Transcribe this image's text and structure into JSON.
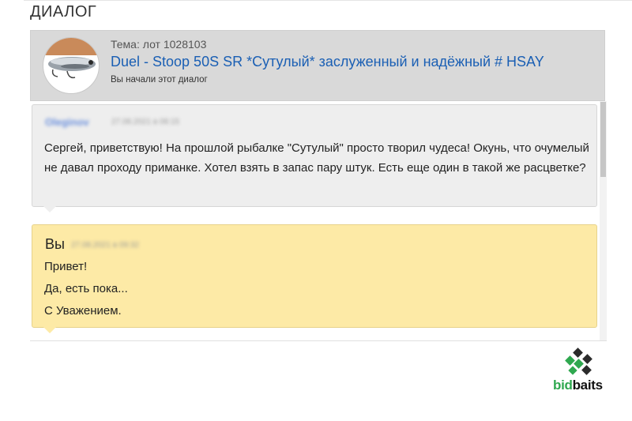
{
  "page": {
    "title": "ДИАЛОГ"
  },
  "topic": {
    "label": "Тема: лот 1028103",
    "link_text": "Duel - Stoop 50S SR *Сутулый* заслуженный и надёжный # HSAY",
    "note": "Вы начали этот диалог"
  },
  "messages": [
    {
      "sender": "Oleginov",
      "timestamp": "27.08.2021 в 08:15",
      "text": "Сергей, приветствую! На прошлой рыбалке \"Сутулый\" просто творил чудеса! Окунь, что очумелый не давал проходу приманке. Хотел взять в запас пару штук. Есть еще один в такой же расцветке?"
    },
    {
      "sender": "Вы",
      "timestamp": "27.08.2021 в 09:32",
      "lines": [
        "Привет!",
        "Да, есть пока...",
        "С Уважением."
      ]
    }
  ],
  "brand": {
    "part1": "bid",
    "part2": "baits"
  },
  "colors": {
    "link": "#1a5fb4",
    "incoming_bg": "#eeeeee",
    "outgoing_bg": "#fdeaa6",
    "topic_bg": "#d9d9d9",
    "brand_green": "#2fa84f"
  }
}
